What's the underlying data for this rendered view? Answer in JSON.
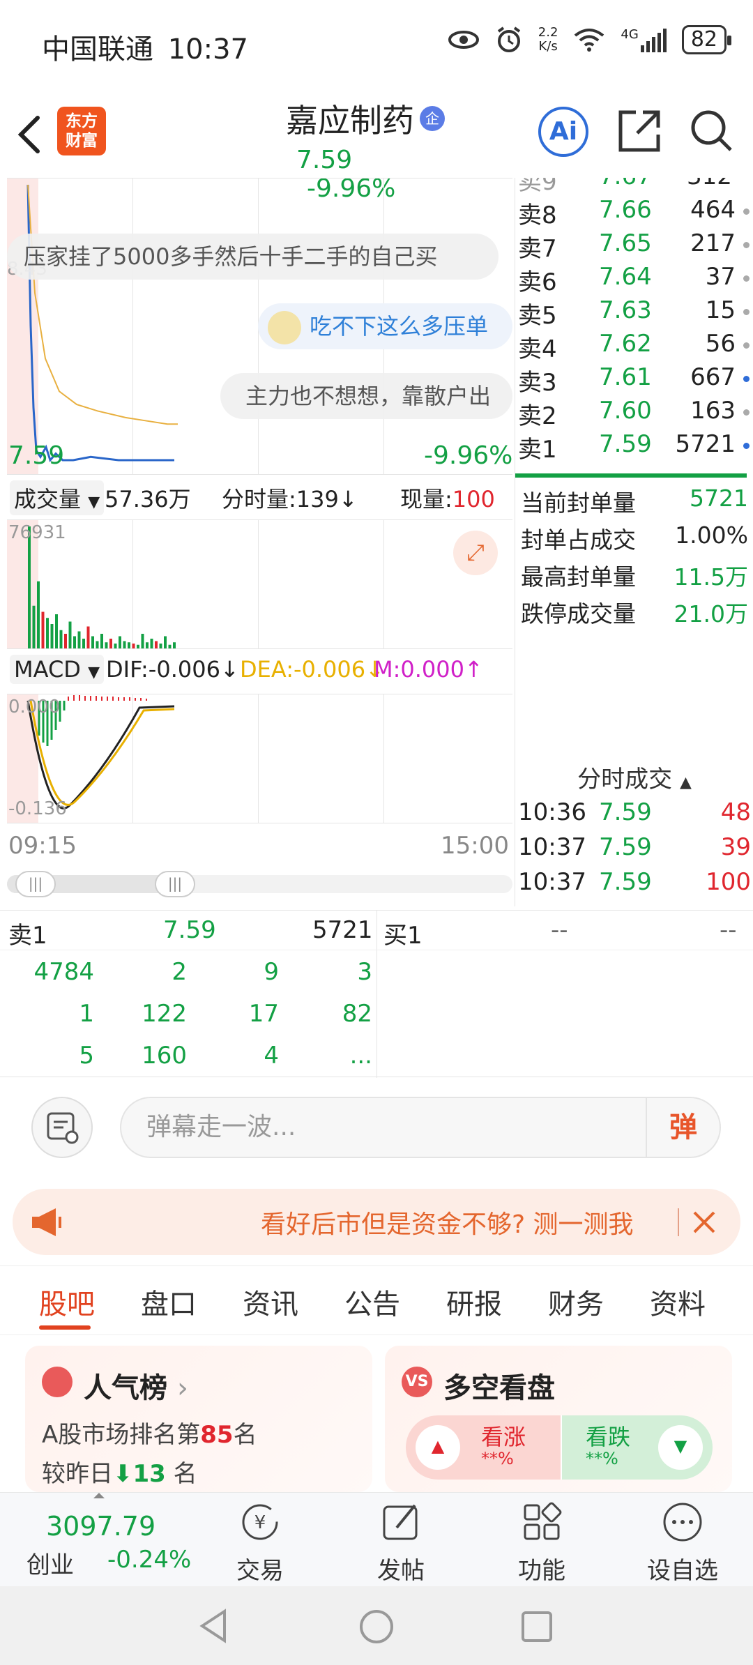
{
  "status_bar": {
    "carrier": "中国联通",
    "time": "10:37",
    "net_speed_top": "2.2",
    "net_speed_bottom": "K/s",
    "network": "4G",
    "battery": "82"
  },
  "header": {
    "logo_line1": "东方",
    "logo_line2": "财富",
    "stock_name": "嘉应制药",
    "badge": "企",
    "price": "7.59",
    "change_pct": "-9.96%",
    "ai_label": "Ai"
  },
  "chart": {
    "price_label_left": "7.59",
    "pct_label_right": "-9.96%",
    "top_partial_label": "8.43",
    "bullets": [
      "压家挂了5000多手然后十手二手的自己买",
      "吃不下这么多压单",
      "主力也不想想，靠散户出"
    ],
    "volume_selector": "成交量",
    "volume_total": "57.36万",
    "volume_label": "分时量:139↓",
    "now_label": "现量:",
    "now_value": "100",
    "volume_max": "76931",
    "macd_selector": "MACD",
    "dif": "DIF:-0.006↓",
    "dea": "DEA:-0.006↓",
    "m": "M:0.000↑",
    "macd_top": "0.000",
    "macd_bottom": "-0.136",
    "time_start": "09:15",
    "time_end": "15:00",
    "price_series_blue": [
      8.43,
      8.0,
      7.75,
      7.62,
      7.6,
      7.63,
      7.59,
      7.61,
      7.59,
      7.59,
      7.6,
      7.59,
      7.59
    ],
    "price_series_yellow": [
      8.43,
      8.1,
      7.9,
      7.8,
      7.76,
      7.74,
      7.72,
      7.71,
      7.7,
      7.7
    ],
    "volume_bars": [
      1.0,
      0.35,
      0.55,
      0.3,
      0.25,
      0.2,
      0.28,
      0.15,
      0.12,
      0.22,
      0.1,
      0.14,
      0.08,
      0.18,
      0.1,
      0.06,
      0.12,
      0.05,
      0.08,
      0.04,
      0.1,
      0.06,
      0.05,
      0.04,
      0.03,
      0.12,
      0.05,
      0.08,
      0.06,
      0.04,
      0.1,
      0.03,
      0.05
    ]
  },
  "order_book": {
    "sell": [
      {
        "label": "卖8",
        "price": "7.66",
        "vol": "464",
        "dot": "gray"
      },
      {
        "label": "卖7",
        "price": "7.65",
        "vol": "217",
        "dot": "gray"
      },
      {
        "label": "卖6",
        "price": "7.64",
        "vol": "37",
        "dot": "gray"
      },
      {
        "label": "卖5",
        "price": "7.63",
        "vol": "15",
        "dot": "gray"
      },
      {
        "label": "卖4",
        "price": "7.62",
        "vol": "56",
        "dot": "gray"
      },
      {
        "label": "卖3",
        "price": "7.61",
        "vol": "667",
        "dot": "blue"
      },
      {
        "label": "卖2",
        "price": "7.60",
        "vol": "163",
        "dot": "gray"
      },
      {
        "label": "卖1",
        "price": "7.59",
        "vol": "5721",
        "dot": "blue"
      }
    ],
    "seal": [
      {
        "label": "当前封单量",
        "value": "5721"
      },
      {
        "label": "封单占成交",
        "value": "1.00%"
      },
      {
        "label": "最高封单量",
        "value": "11.5万"
      },
      {
        "label": "跌停成交量",
        "value": "21.0万"
      }
    ],
    "ticks_title": "分时成交",
    "ticks": [
      {
        "time": "10:36",
        "price": "7.59",
        "vol": "48"
      },
      {
        "time": "10:37",
        "price": "7.59",
        "vol": "39"
      },
      {
        "time": "10:37",
        "price": "7.59",
        "vol": "100"
      }
    ]
  },
  "queue": {
    "sell_label": "卖1",
    "sell_price": "7.59",
    "sell_total": "5721",
    "buy_label": "买1",
    "buy_price": "--",
    "buy_total": "--",
    "rows": [
      [
        "4784",
        "2",
        "9",
        "3"
      ],
      [
        "1",
        "122",
        "17",
        "82"
      ],
      [
        "5",
        "160",
        "4",
        "..."
      ]
    ]
  },
  "danmaku": {
    "placeholder": "弹幕走一波...",
    "send_label": "弹"
  },
  "promo": {
    "text": "看好后市但是资金不够? 测一测我"
  },
  "tabs": [
    "股吧",
    "盘口",
    "资讯",
    "公告",
    "研报",
    "财务",
    "资料"
  ],
  "cards": {
    "popularity": {
      "title": "人气榜",
      "line1_prefix": "A股市场排名第",
      "rank": "85",
      "line1_suffix": "名",
      "line2_prefix": "较昨日",
      "change": "13",
      "line2_suffix": "名"
    },
    "bullbear": {
      "title": "多空看盘",
      "up_label": "看涨",
      "up_value": "**%",
      "down_label": "看跌",
      "down_value": "**%"
    }
  },
  "bottom_nav": {
    "index_value": "3097.79",
    "index_name": "创业",
    "index_change": "-0.24%",
    "items": [
      "交易",
      "发帖",
      "功能",
      "设自选"
    ]
  }
}
